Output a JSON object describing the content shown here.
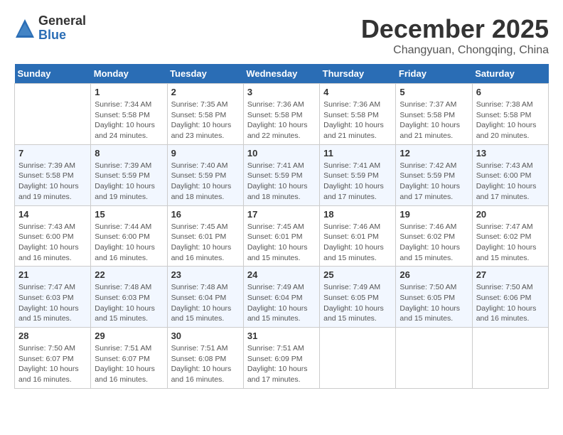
{
  "logo": {
    "general": "General",
    "blue": "Blue"
  },
  "title": "December 2025",
  "location": "Changyuan, Chongqing, China",
  "weekdays": [
    "Sunday",
    "Monday",
    "Tuesday",
    "Wednesday",
    "Thursday",
    "Friday",
    "Saturday"
  ],
  "weeks": [
    [
      {
        "date": "",
        "info": ""
      },
      {
        "date": "1",
        "info": "Sunrise: 7:34 AM\nSunset: 5:58 PM\nDaylight: 10 hours\nand 24 minutes."
      },
      {
        "date": "2",
        "info": "Sunrise: 7:35 AM\nSunset: 5:58 PM\nDaylight: 10 hours\nand 23 minutes."
      },
      {
        "date": "3",
        "info": "Sunrise: 7:36 AM\nSunset: 5:58 PM\nDaylight: 10 hours\nand 22 minutes."
      },
      {
        "date": "4",
        "info": "Sunrise: 7:36 AM\nSunset: 5:58 PM\nDaylight: 10 hours\nand 21 minutes."
      },
      {
        "date": "5",
        "info": "Sunrise: 7:37 AM\nSunset: 5:58 PM\nDaylight: 10 hours\nand 21 minutes."
      },
      {
        "date": "6",
        "info": "Sunrise: 7:38 AM\nSunset: 5:58 PM\nDaylight: 10 hours\nand 20 minutes."
      }
    ],
    [
      {
        "date": "7",
        "info": "Sunrise: 7:39 AM\nSunset: 5:58 PM\nDaylight: 10 hours\nand 19 minutes."
      },
      {
        "date": "8",
        "info": "Sunrise: 7:39 AM\nSunset: 5:59 PM\nDaylight: 10 hours\nand 19 minutes."
      },
      {
        "date": "9",
        "info": "Sunrise: 7:40 AM\nSunset: 5:59 PM\nDaylight: 10 hours\nand 18 minutes."
      },
      {
        "date": "10",
        "info": "Sunrise: 7:41 AM\nSunset: 5:59 PM\nDaylight: 10 hours\nand 18 minutes."
      },
      {
        "date": "11",
        "info": "Sunrise: 7:41 AM\nSunset: 5:59 PM\nDaylight: 10 hours\nand 17 minutes."
      },
      {
        "date": "12",
        "info": "Sunrise: 7:42 AM\nSunset: 5:59 PM\nDaylight: 10 hours\nand 17 minutes."
      },
      {
        "date": "13",
        "info": "Sunrise: 7:43 AM\nSunset: 6:00 PM\nDaylight: 10 hours\nand 17 minutes."
      }
    ],
    [
      {
        "date": "14",
        "info": "Sunrise: 7:43 AM\nSunset: 6:00 PM\nDaylight: 10 hours\nand 16 minutes."
      },
      {
        "date": "15",
        "info": "Sunrise: 7:44 AM\nSunset: 6:00 PM\nDaylight: 10 hours\nand 16 minutes."
      },
      {
        "date": "16",
        "info": "Sunrise: 7:45 AM\nSunset: 6:01 PM\nDaylight: 10 hours\nand 16 minutes."
      },
      {
        "date": "17",
        "info": "Sunrise: 7:45 AM\nSunset: 6:01 PM\nDaylight: 10 hours\nand 15 minutes."
      },
      {
        "date": "18",
        "info": "Sunrise: 7:46 AM\nSunset: 6:01 PM\nDaylight: 10 hours\nand 15 minutes."
      },
      {
        "date": "19",
        "info": "Sunrise: 7:46 AM\nSunset: 6:02 PM\nDaylight: 10 hours\nand 15 minutes."
      },
      {
        "date": "20",
        "info": "Sunrise: 7:47 AM\nSunset: 6:02 PM\nDaylight: 10 hours\nand 15 minutes."
      }
    ],
    [
      {
        "date": "21",
        "info": "Sunrise: 7:47 AM\nSunset: 6:03 PM\nDaylight: 10 hours\nand 15 minutes."
      },
      {
        "date": "22",
        "info": "Sunrise: 7:48 AM\nSunset: 6:03 PM\nDaylight: 10 hours\nand 15 minutes."
      },
      {
        "date": "23",
        "info": "Sunrise: 7:48 AM\nSunset: 6:04 PM\nDaylight: 10 hours\nand 15 minutes."
      },
      {
        "date": "24",
        "info": "Sunrise: 7:49 AM\nSunset: 6:04 PM\nDaylight: 10 hours\nand 15 minutes."
      },
      {
        "date": "25",
        "info": "Sunrise: 7:49 AM\nSunset: 6:05 PM\nDaylight: 10 hours\nand 15 minutes."
      },
      {
        "date": "26",
        "info": "Sunrise: 7:50 AM\nSunset: 6:05 PM\nDaylight: 10 hours\nand 15 minutes."
      },
      {
        "date": "27",
        "info": "Sunrise: 7:50 AM\nSunset: 6:06 PM\nDaylight: 10 hours\nand 16 minutes."
      }
    ],
    [
      {
        "date": "28",
        "info": "Sunrise: 7:50 AM\nSunset: 6:07 PM\nDaylight: 10 hours\nand 16 minutes."
      },
      {
        "date": "29",
        "info": "Sunrise: 7:51 AM\nSunset: 6:07 PM\nDaylight: 10 hours\nand 16 minutes."
      },
      {
        "date": "30",
        "info": "Sunrise: 7:51 AM\nSunset: 6:08 PM\nDaylight: 10 hours\nand 16 minutes."
      },
      {
        "date": "31",
        "info": "Sunrise: 7:51 AM\nSunset: 6:09 PM\nDaylight: 10 hours\nand 17 minutes."
      },
      {
        "date": "",
        "info": ""
      },
      {
        "date": "",
        "info": ""
      },
      {
        "date": "",
        "info": ""
      }
    ]
  ]
}
